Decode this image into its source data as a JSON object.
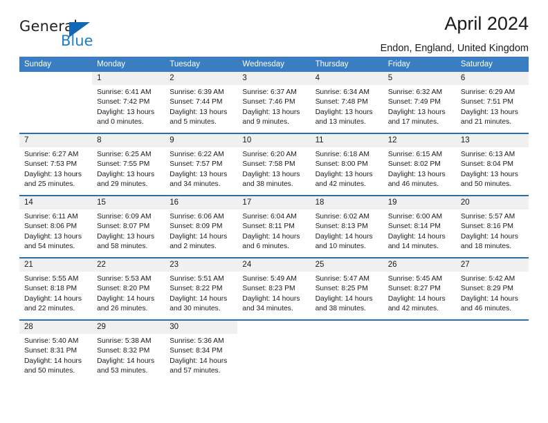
{
  "logo": {
    "word_one": "General",
    "word_two": "Blue",
    "triangle_icon": "triangle-icon",
    "accent_dark": "#231f20",
    "accent_blue": "#1a7fc1"
  },
  "header": {
    "title": "April 2024",
    "subtitle": "Endon, England, United Kingdom"
  },
  "theme": {
    "header_bg": "#3a7ec1",
    "row_divider": "#2e6da4",
    "daynum_bg": "#f0f0f0",
    "text": "#1a1a1a"
  },
  "calendar": {
    "weekday_headers": [
      "Sunday",
      "Monday",
      "Tuesday",
      "Wednesday",
      "Thursday",
      "Friday",
      "Saturday"
    ],
    "weeks": [
      [
        {
          "day": "",
          "sunrise": "",
          "sunset": "",
          "daylight_line1": "",
          "daylight_line2": ""
        },
        {
          "day": "1",
          "sunrise": "Sunrise: 6:41 AM",
          "sunset": "Sunset: 7:42 PM",
          "daylight_line1": "Daylight: 13 hours",
          "daylight_line2": "and 0 minutes."
        },
        {
          "day": "2",
          "sunrise": "Sunrise: 6:39 AM",
          "sunset": "Sunset: 7:44 PM",
          "daylight_line1": "Daylight: 13 hours",
          "daylight_line2": "and 5 minutes."
        },
        {
          "day": "3",
          "sunrise": "Sunrise: 6:37 AM",
          "sunset": "Sunset: 7:46 PM",
          "daylight_line1": "Daylight: 13 hours",
          "daylight_line2": "and 9 minutes."
        },
        {
          "day": "4",
          "sunrise": "Sunrise: 6:34 AM",
          "sunset": "Sunset: 7:48 PM",
          "daylight_line1": "Daylight: 13 hours",
          "daylight_line2": "and 13 minutes."
        },
        {
          "day": "5",
          "sunrise": "Sunrise: 6:32 AM",
          "sunset": "Sunset: 7:49 PM",
          "daylight_line1": "Daylight: 13 hours",
          "daylight_line2": "and 17 minutes."
        },
        {
          "day": "6",
          "sunrise": "Sunrise: 6:29 AM",
          "sunset": "Sunset: 7:51 PM",
          "daylight_line1": "Daylight: 13 hours",
          "daylight_line2": "and 21 minutes."
        }
      ],
      [
        {
          "day": "7",
          "sunrise": "Sunrise: 6:27 AM",
          "sunset": "Sunset: 7:53 PM",
          "daylight_line1": "Daylight: 13 hours",
          "daylight_line2": "and 25 minutes."
        },
        {
          "day": "8",
          "sunrise": "Sunrise: 6:25 AM",
          "sunset": "Sunset: 7:55 PM",
          "daylight_line1": "Daylight: 13 hours",
          "daylight_line2": "and 29 minutes."
        },
        {
          "day": "9",
          "sunrise": "Sunrise: 6:22 AM",
          "sunset": "Sunset: 7:57 PM",
          "daylight_line1": "Daylight: 13 hours",
          "daylight_line2": "and 34 minutes."
        },
        {
          "day": "10",
          "sunrise": "Sunrise: 6:20 AM",
          "sunset": "Sunset: 7:58 PM",
          "daylight_line1": "Daylight: 13 hours",
          "daylight_line2": "and 38 minutes."
        },
        {
          "day": "11",
          "sunrise": "Sunrise: 6:18 AM",
          "sunset": "Sunset: 8:00 PM",
          "daylight_line1": "Daylight: 13 hours",
          "daylight_line2": "and 42 minutes."
        },
        {
          "day": "12",
          "sunrise": "Sunrise: 6:15 AM",
          "sunset": "Sunset: 8:02 PM",
          "daylight_line1": "Daylight: 13 hours",
          "daylight_line2": "and 46 minutes."
        },
        {
          "day": "13",
          "sunrise": "Sunrise: 6:13 AM",
          "sunset": "Sunset: 8:04 PM",
          "daylight_line1": "Daylight: 13 hours",
          "daylight_line2": "and 50 minutes."
        }
      ],
      [
        {
          "day": "14",
          "sunrise": "Sunrise: 6:11 AM",
          "sunset": "Sunset: 8:06 PM",
          "daylight_line1": "Daylight: 13 hours",
          "daylight_line2": "and 54 minutes."
        },
        {
          "day": "15",
          "sunrise": "Sunrise: 6:09 AM",
          "sunset": "Sunset: 8:07 PM",
          "daylight_line1": "Daylight: 13 hours",
          "daylight_line2": "and 58 minutes."
        },
        {
          "day": "16",
          "sunrise": "Sunrise: 6:06 AM",
          "sunset": "Sunset: 8:09 PM",
          "daylight_line1": "Daylight: 14 hours",
          "daylight_line2": "and 2 minutes."
        },
        {
          "day": "17",
          "sunrise": "Sunrise: 6:04 AM",
          "sunset": "Sunset: 8:11 PM",
          "daylight_line1": "Daylight: 14 hours",
          "daylight_line2": "and 6 minutes."
        },
        {
          "day": "18",
          "sunrise": "Sunrise: 6:02 AM",
          "sunset": "Sunset: 8:13 PM",
          "daylight_line1": "Daylight: 14 hours",
          "daylight_line2": "and 10 minutes."
        },
        {
          "day": "19",
          "sunrise": "Sunrise: 6:00 AM",
          "sunset": "Sunset: 8:14 PM",
          "daylight_line1": "Daylight: 14 hours",
          "daylight_line2": "and 14 minutes."
        },
        {
          "day": "20",
          "sunrise": "Sunrise: 5:57 AM",
          "sunset": "Sunset: 8:16 PM",
          "daylight_line1": "Daylight: 14 hours",
          "daylight_line2": "and 18 minutes."
        }
      ],
      [
        {
          "day": "21",
          "sunrise": "Sunrise: 5:55 AM",
          "sunset": "Sunset: 8:18 PM",
          "daylight_line1": "Daylight: 14 hours",
          "daylight_line2": "and 22 minutes."
        },
        {
          "day": "22",
          "sunrise": "Sunrise: 5:53 AM",
          "sunset": "Sunset: 8:20 PM",
          "daylight_line1": "Daylight: 14 hours",
          "daylight_line2": "and 26 minutes."
        },
        {
          "day": "23",
          "sunrise": "Sunrise: 5:51 AM",
          "sunset": "Sunset: 8:22 PM",
          "daylight_line1": "Daylight: 14 hours",
          "daylight_line2": "and 30 minutes."
        },
        {
          "day": "24",
          "sunrise": "Sunrise: 5:49 AM",
          "sunset": "Sunset: 8:23 PM",
          "daylight_line1": "Daylight: 14 hours",
          "daylight_line2": "and 34 minutes."
        },
        {
          "day": "25",
          "sunrise": "Sunrise: 5:47 AM",
          "sunset": "Sunset: 8:25 PM",
          "daylight_line1": "Daylight: 14 hours",
          "daylight_line2": "and 38 minutes."
        },
        {
          "day": "26",
          "sunrise": "Sunrise: 5:45 AM",
          "sunset": "Sunset: 8:27 PM",
          "daylight_line1": "Daylight: 14 hours",
          "daylight_line2": "and 42 minutes."
        },
        {
          "day": "27",
          "sunrise": "Sunrise: 5:42 AM",
          "sunset": "Sunset: 8:29 PM",
          "daylight_line1": "Daylight: 14 hours",
          "daylight_line2": "and 46 minutes."
        }
      ],
      [
        {
          "day": "28",
          "sunrise": "Sunrise: 5:40 AM",
          "sunset": "Sunset: 8:31 PM",
          "daylight_line1": "Daylight: 14 hours",
          "daylight_line2": "and 50 minutes."
        },
        {
          "day": "29",
          "sunrise": "Sunrise: 5:38 AM",
          "sunset": "Sunset: 8:32 PM",
          "daylight_line1": "Daylight: 14 hours",
          "daylight_line2": "and 53 minutes."
        },
        {
          "day": "30",
          "sunrise": "Sunrise: 5:36 AM",
          "sunset": "Sunset: 8:34 PM",
          "daylight_line1": "Daylight: 14 hours",
          "daylight_line2": "and 57 minutes."
        },
        {
          "day": "",
          "sunrise": "",
          "sunset": "",
          "daylight_line1": "",
          "daylight_line2": ""
        },
        {
          "day": "",
          "sunrise": "",
          "sunset": "",
          "daylight_line1": "",
          "daylight_line2": ""
        },
        {
          "day": "",
          "sunrise": "",
          "sunset": "",
          "daylight_line1": "",
          "daylight_line2": ""
        },
        {
          "day": "",
          "sunrise": "",
          "sunset": "",
          "daylight_line1": "",
          "daylight_line2": ""
        }
      ]
    ]
  }
}
